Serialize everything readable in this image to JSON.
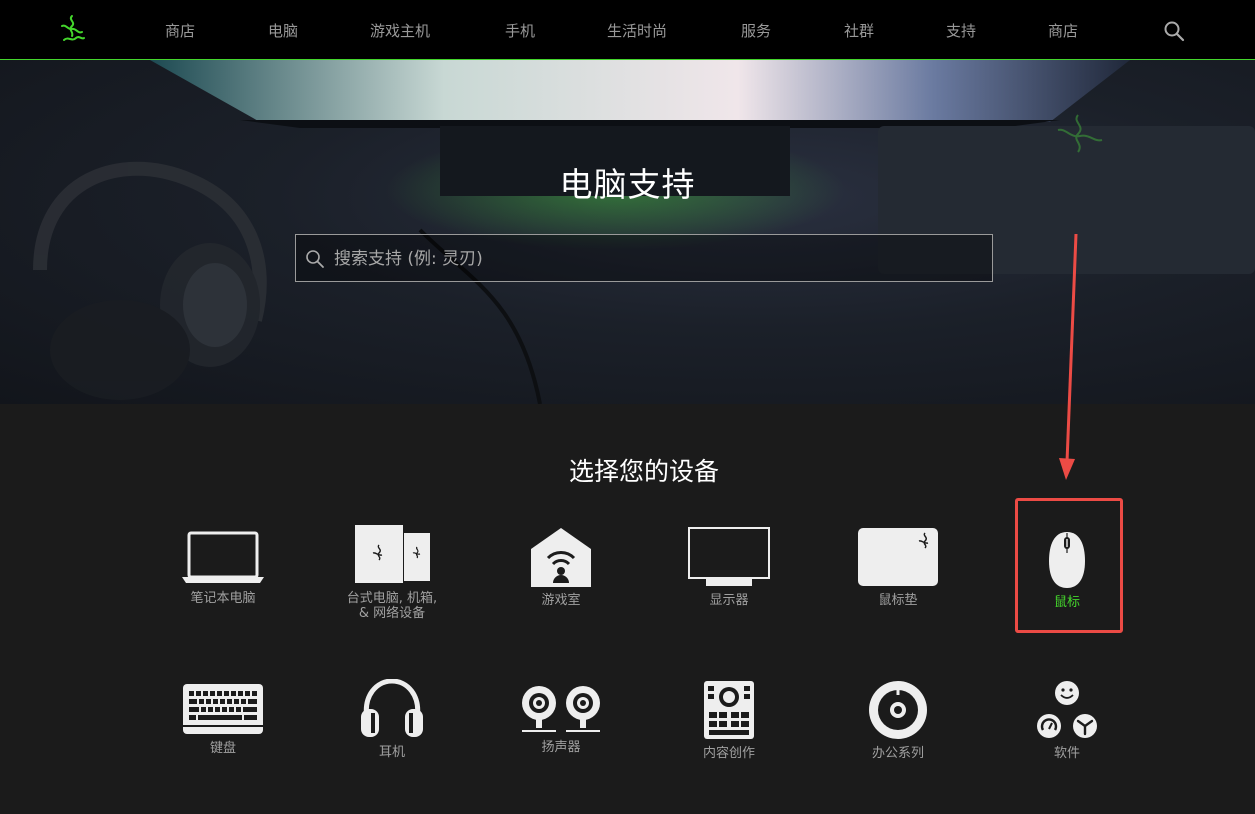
{
  "nav": {
    "items": [
      "商店",
      "电脑",
      "游戏主机",
      "手机",
      "生活时尚",
      "服务",
      "社群",
      "支持",
      "商店"
    ]
  },
  "hero": {
    "title": "电脑支持",
    "search_placeholder": "搜索支持 (例: 灵刃)"
  },
  "devices": {
    "title": "选择您的设备",
    "items": [
      {
        "label": "笔记本电脑",
        "icon": "laptop-icon"
      },
      {
        "label_line1": "台式电脑, 机箱,",
        "label_line2": "& 网络设备",
        "icon": "desktop-icon"
      },
      {
        "label": "游戏室",
        "icon": "gaming-room-icon"
      },
      {
        "label": "显示器",
        "icon": "monitor-icon"
      },
      {
        "label": "鼠标垫",
        "icon": "mousepad-icon"
      },
      {
        "label": "鼠标",
        "icon": "mouse-icon",
        "selected": true
      },
      {
        "label": "键盘",
        "icon": "keyboard-icon"
      },
      {
        "label": "耳机",
        "icon": "headset-icon"
      },
      {
        "label": "扬声器",
        "icon": "speaker-icon"
      },
      {
        "label": "内容创作",
        "icon": "content-creation-icon"
      },
      {
        "label": "办公系列",
        "icon": "office-icon"
      },
      {
        "label": "软件",
        "icon": "software-icon"
      }
    ]
  },
  "colors": {
    "accent": "#44d62c",
    "highlight": "#ec4b45",
    "nav_bg": "#000000",
    "page_bg": "#1b1b1b"
  }
}
